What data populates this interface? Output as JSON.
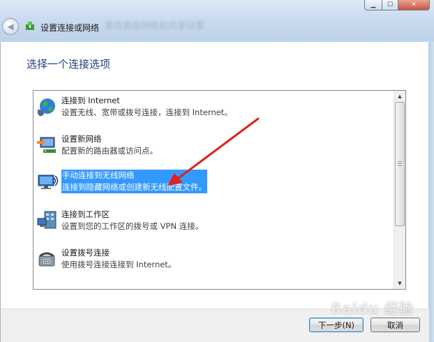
{
  "window": {
    "title": "设置连接或网络",
    "ghost_title": "更改高级网络和共享设置"
  },
  "heading": "选择一个连接选项",
  "options": [
    {
      "title": "连接到 Internet",
      "desc": "设置无线、宽带或拨号连接，连接到 Internet。",
      "icon": "globe-network-icon",
      "selected": false
    },
    {
      "title": "设置新网络",
      "desc": "配置新的路由器或访问点。",
      "icon": "router-setup-icon",
      "selected": false
    },
    {
      "title": "手动连接到无线网络",
      "desc": "连接到隐藏网络或创建新无线配置文件。",
      "icon": "wireless-monitor-icon",
      "selected": true
    },
    {
      "title": "连接到工作区",
      "desc": "设置到您的工作区的拨号或 VPN 连接。",
      "icon": "workplace-icon",
      "selected": false
    },
    {
      "title": "设置拨号连接",
      "desc": "使用拨号连接连接到 Internet。",
      "icon": "phone-modem-icon",
      "selected": false
    }
  ],
  "buttons": {
    "next": "下一步(N)",
    "cancel": "取消"
  },
  "watermark": "Baidu 经验",
  "colors": {
    "selection": "#3399ff",
    "heading": "#1e3f80",
    "arrow": "#e0201a"
  }
}
